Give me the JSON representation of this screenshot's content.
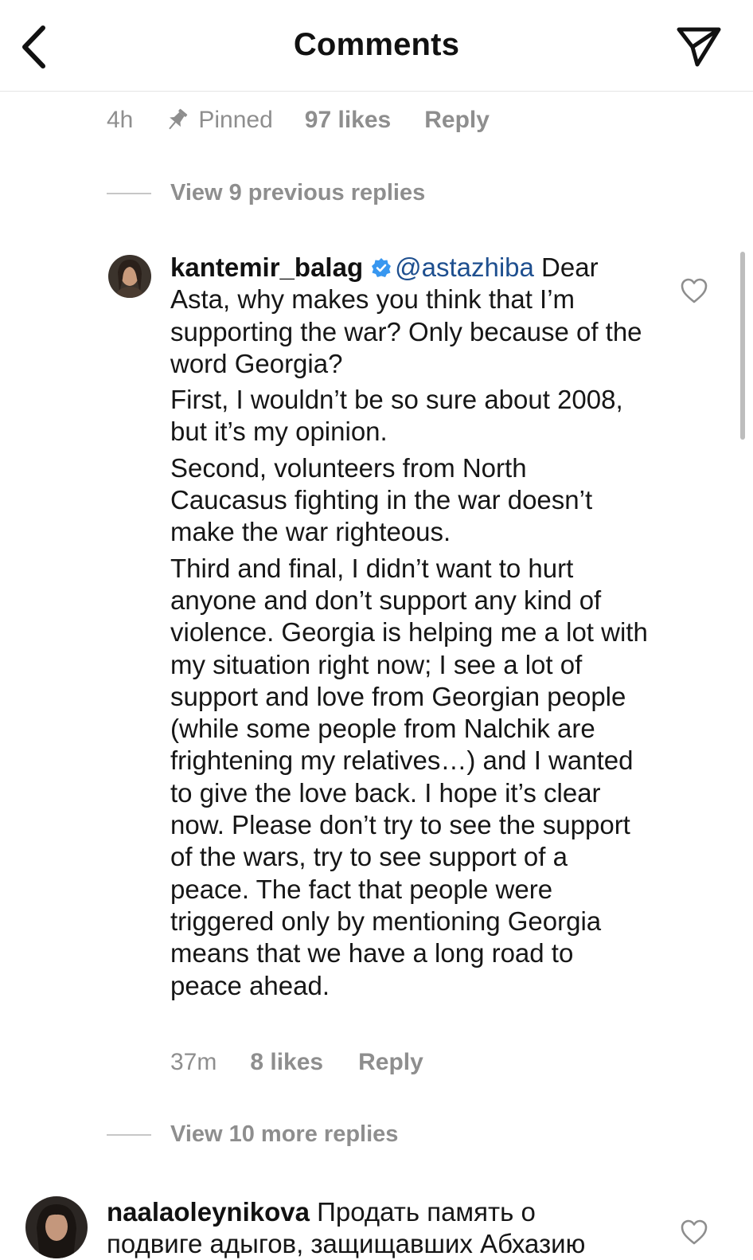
{
  "header": {
    "title": "Comments",
    "back_icon": "chevron-left-icon",
    "send_icon": "paper-plane-icon"
  },
  "pinned_meta": {
    "time": "4h",
    "pinned_label": "Pinned",
    "likes": "97 likes",
    "reply_label": "Reply"
  },
  "view_previous": "View 9 previous replies",
  "reply": {
    "username": "kantemir_balag",
    "mention": "@astazhiba",
    "paragraphs": [
      " Dear Asta, why makes you think that I’m supporting the war? Only because of the word Georgia?",
      "First, I wouldn’t be so sure about 2008, but it’s my opinion.",
      "Second, volunteers from North Caucasus fighting in the war doesn’t make the war righteous.",
      "Third and final, I didn’t want to hurt anyone and don’t support any kind of violence. Georgia is helping me a lot with my situation right now; I see a lot of support and love from Georgian people (while some people from Nalchik are frightening my relatives…) and I wanted to give the love back. I hope it’s clear now. Please don’t try to see the support of the wars, try to see support of a peace. The fact that people were triggered only by mentioning Georgia means that we have a long road to peace ahead."
    ],
    "time": "37m",
    "likes": "8 likes",
    "reply_label": "Reply"
  },
  "view_more": "View 10 more replies",
  "comment2": {
    "username": "naalaoleynikova",
    "line1": " Продать память о",
    "line2": "подвиге адыгов, защищавших Абхазию"
  },
  "colors": {
    "meta_gray": "#8e8e8e",
    "mention_blue": "#1e4f8f",
    "verified_blue": "#3897f0",
    "divider": "#e4e4e4"
  }
}
